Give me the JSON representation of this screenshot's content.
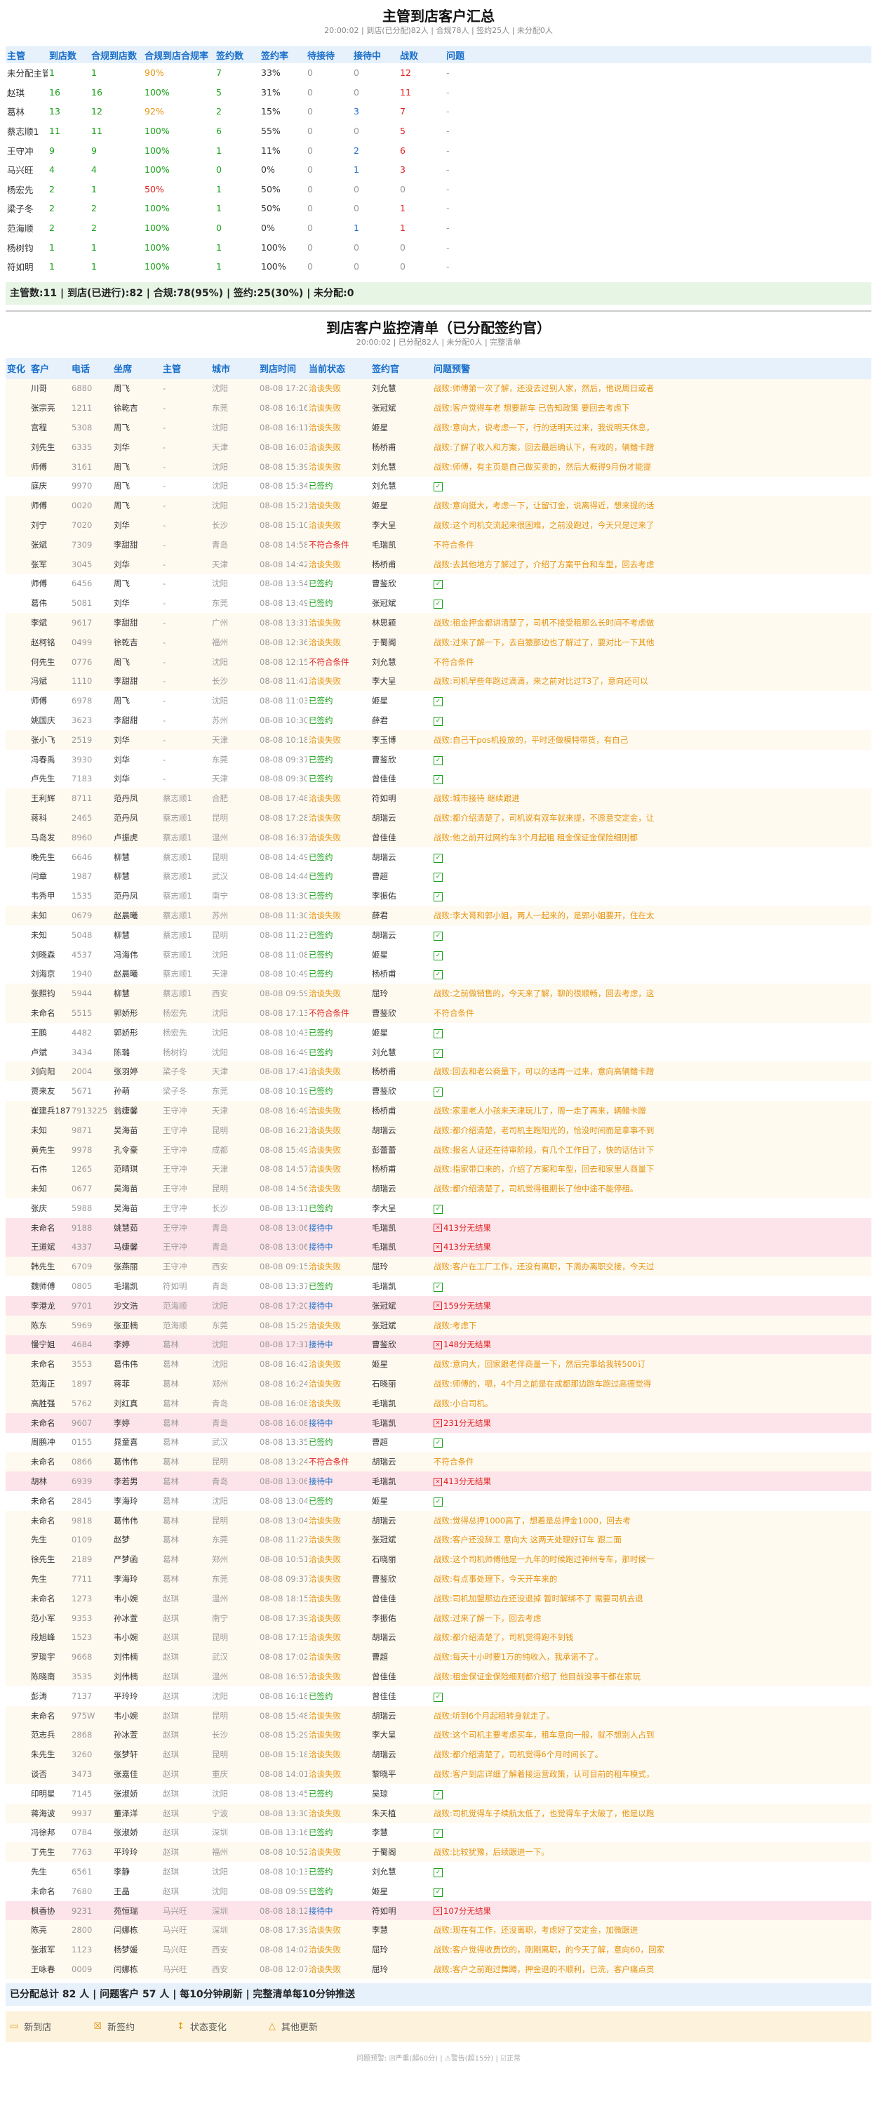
{
  "summary": {
    "title": "主管到店客户汇总",
    "subtitle": "20:00:02 | 到店(已分配)82人 | 合规78人 | 签约25人 | 未分配0人",
    "headers": [
      "主管",
      "到店数",
      "合规到店数",
      "合规到店合规率",
      "签约数",
      "签约率",
      "待接待",
      "接待中",
      "战败",
      "问题"
    ],
    "rows": [
      [
        "未分配主管",
        1,
        1,
        "90%",
        7,
        "33%",
        0,
        0,
        12,
        "-"
      ],
      [
        "赵琪",
        16,
        16,
        "100%",
        5,
        "31%",
        0,
        0,
        11,
        "-"
      ],
      [
        "葛林",
        13,
        12,
        "92%",
        2,
        "15%",
        0,
        3,
        7,
        "-"
      ],
      [
        "蔡志顺1",
        11,
        11,
        "100%",
        6,
        "55%",
        0,
        0,
        5,
        "-"
      ],
      [
        "王守冲",
        9,
        9,
        "100%",
        1,
        "11%",
        0,
        2,
        6,
        "-"
      ],
      [
        "马兴旺",
        4,
        4,
        "100%",
        0,
        "0%",
        0,
        1,
        3,
        "-"
      ],
      [
        "杨宏先",
        2,
        1,
        "50%",
        1,
        "50%",
        0,
        0,
        0,
        "-"
      ],
      [
        "梁子冬",
        2,
        2,
        "100%",
        1,
        "50%",
        0,
        0,
        1,
        "-"
      ],
      [
        "范海顺",
        2,
        2,
        "100%",
        0,
        "0%",
        0,
        1,
        1,
        "-"
      ],
      [
        "杨树钧",
        1,
        1,
        "100%",
        1,
        "100%",
        0,
        0,
        0,
        "-"
      ],
      [
        "符如明",
        1,
        1,
        "100%",
        1,
        "100%",
        0,
        0,
        0,
        "-"
      ]
    ],
    "total": "主管数:11 | 到店(已进行):82 | 合规:78(95%) | 签约:25(30%) | 未分配:0"
  },
  "monitor": {
    "title": "到店客户监控清单（已分配签约官）",
    "subtitle": "20:00:02 | 已分配82人 | 未分配0人 | 完整清单",
    "headers": [
      "变化",
      "客户",
      "电话",
      "坐席",
      "主管",
      "城市",
      "到店时间",
      "当前状态",
      "签约官",
      "问题预警"
    ],
    "rows": [
      [
        "",
        "川哥",
        "6880",
        "周飞",
        "-",
        "沈阳",
        "08-08 17:20",
        "洽谈失败",
        "刘允慧",
        "战败:师傅第一次了解，还没去过别人家，然后，他说周日或者",
        "w"
      ],
      [
        "",
        "张宗亮",
        "1211",
        "徐乾吉",
        "-",
        "东莞",
        "08-08 16:16",
        "洽谈失败",
        "张冠斌",
        "战败:客户觉得车老 想要新车 已告知政策 要回去考虑下",
        "w"
      ],
      [
        "",
        "宫程",
        "5308",
        "周飞",
        "-",
        "沈阳",
        "08-08 16:11",
        "洽谈失败",
        "姬星",
        "战败:意向大，说考虑一下，行的话明天过来，我说明天休息，",
        "w"
      ],
      [
        "",
        "刘先生",
        "6335",
        "刘华",
        "-",
        "天津",
        "08-08 16:03",
        "洽谈失败",
        "杨桥甫",
        "战败:了解了收入和方案，回去最后确认下，有戏的，辆鳍卡蹭",
        "w"
      ],
      [
        "",
        "师傅",
        "3161",
        "周飞",
        "-",
        "沈阳",
        "08-08 15:39",
        "洽谈失败",
        "刘允慧",
        "战败:师傅，有主页是自己做买卖的，然后大概得9月份才能提",
        "w"
      ],
      [
        "",
        "庭庆",
        "9970",
        "周飞",
        "-",
        "沈阳",
        "08-08 15:34",
        "已签约",
        "刘允慧",
        "",
        "ok"
      ],
      [
        "",
        "师傅",
        "0020",
        "周飞",
        "-",
        "沈阳",
        "08-08 15:21",
        "洽谈失败",
        "姬星",
        "战败:意向挺大，考虑一下，让留订金，说离得近，想来提的话",
        "w"
      ],
      [
        "",
        "刘宁",
        "7020",
        "刘华",
        "-",
        "长沙",
        "08-08 15:10",
        "洽谈失败",
        "李大呈",
        "战败:这个司机交流起来很困难，之前没跑过，今天只是过来了",
        "w"
      ],
      [
        "",
        "张斌",
        "7309",
        "李甜甜",
        "-",
        "青岛",
        "08-08 14:58",
        "不符合条件",
        "毛瑞凯",
        "不符合条件",
        "w"
      ],
      [
        "",
        "张军",
        "3045",
        "刘华",
        "-",
        "天津",
        "08-08 14:42",
        "洽谈失败",
        "杨桥甫",
        "战败:去其他地方了解过了，介绍了方案平台和车型，回去考虑",
        "w"
      ],
      [
        "",
        "师傅",
        "6456",
        "周飞",
        "-",
        "沈阳",
        "08-08 13:54",
        "已签约",
        "曹鉴欣",
        "",
        "ok"
      ],
      [
        "",
        "葛伟",
        "5081",
        "刘华",
        "-",
        "东莞",
        "08-08 13:49",
        "已签约",
        "张冠斌",
        "",
        "ok"
      ],
      [
        "",
        "李斌",
        "9617",
        "李甜甜",
        "-",
        "广州",
        "08-08 13:31",
        "洽谈失败",
        "林思颖",
        "战败:租金押金都讲清楚了，司机不接受租那么长时间不考虑做",
        "w"
      ],
      [
        "",
        "赵柯铭",
        "0499",
        "徐乾吉",
        "-",
        "福州",
        "08-08 12:36",
        "洽谈失败",
        "于蜀阁",
        "战败:过来了解一下，去自猿那边也了解过了，要对比一下其他",
        "w"
      ],
      [
        "",
        "何先生",
        "0776",
        "周飞",
        "-",
        "沈阳",
        "08-08 12:15",
        "不符合条件",
        "刘允慧",
        "不符合条件",
        "w"
      ],
      [
        "",
        "冯斌",
        "1110",
        "李甜甜",
        "-",
        "长沙",
        "08-08 11:41",
        "洽谈失败",
        "李大呈",
        "战败:司机早些年跑过滴滴，来之前对比过T3了，意向还可以",
        "w"
      ],
      [
        "",
        "师傅",
        "6978",
        "周飞",
        "-",
        "沈阳",
        "08-08 11:03",
        "已签约",
        "姬星",
        "",
        "ok"
      ],
      [
        "",
        "姚国庆",
        "3623",
        "李甜甜",
        "-",
        "苏州",
        "08-08 10:30",
        "已签约",
        "薛君",
        "",
        "ok"
      ],
      [
        "",
        "张小飞",
        "2519",
        "刘华",
        "-",
        "天津",
        "08-08 10:18",
        "洽谈失败",
        "李玉博",
        "战败:自己干pos机投放的，平时还做模特带货，有自己",
        "w"
      ],
      [
        "",
        "冯春禹",
        "3930",
        "刘华",
        "-",
        "东莞",
        "08-08 09:37",
        "已签约",
        "曹鉴欣",
        "",
        "ok"
      ],
      [
        "",
        "卢先生",
        "7183",
        "刘华",
        "-",
        "天津",
        "08-08 09:30",
        "已签约",
        "曾佳佳",
        "",
        "ok"
      ],
      [
        "",
        "王利辉",
        "8711",
        "范丹凤",
        "蔡志顺1",
        "合肥",
        "08-08 17:48",
        "洽谈失败",
        "符如明",
        "战败:城市接待 继续跟进",
        "w"
      ],
      [
        "",
        "蒋科",
        "2465",
        "范丹凤",
        "蔡志顺1",
        "昆明",
        "08-08 17:28",
        "洽谈失败",
        "胡瑞云",
        "战败:都介绍清楚了，司机说有双车就来提，不愿意交定金，让",
        "w"
      ],
      [
        "",
        "马岛发",
        "8960",
        "卢振虎",
        "蔡志顺1",
        "温州",
        "08-08 16:37",
        "洽谈失败",
        "曾佳佳",
        "战败:他之前开过网约车3个月起租 租金保证金保险细则都",
        "w"
      ],
      [
        "",
        "晚先生",
        "6646",
        "柳慧",
        "蔡志顺1",
        "昆明",
        "08-08 14:49",
        "已签约",
        "胡瑞云",
        "",
        "ok"
      ],
      [
        "",
        "闫章",
        "1987",
        "柳慧",
        "蔡志顺1",
        "武汉",
        "08-08 14:44",
        "已签约",
        "曹超",
        "",
        "ok"
      ],
      [
        "",
        "韦秀甲",
        "1535",
        "范丹凤",
        "蔡志顺1",
        "南宁",
        "08-08 13:30",
        "已签约",
        "李振佑",
        "",
        "ok"
      ],
      [
        "",
        "未知",
        "0679",
        "赵晨曦",
        "蔡志顺1",
        "苏州",
        "08-08 11:30",
        "洽谈失败",
        "薛君",
        "战败:李大哥和郭小姐，两人一起来的，是郭小姐要开，住在太",
        "w"
      ],
      [
        "",
        "未知",
        "5048",
        "柳慧",
        "蔡志顺1",
        "昆明",
        "08-08 11:23",
        "已签约",
        "胡瑞云",
        "",
        "ok"
      ],
      [
        "",
        "刘晓森",
        "4537",
        "冯海伟",
        "蔡志顺1",
        "沈阳",
        "08-08 11:08",
        "已签约",
        "姬星",
        "",
        "ok"
      ],
      [
        "",
        "刘海京",
        "1940",
        "赵晨曦",
        "蔡志顺1",
        "天津",
        "08-08 10:49",
        "已签约",
        "杨桥甫",
        "",
        "ok"
      ],
      [
        "",
        "张照钧",
        "5944",
        "柳慧",
        "蔡志顺1",
        "西安",
        "08-08 09:59",
        "洽谈失败",
        "屈玲",
        "战败:之前做销售的，今天来了解，聊的很顺畅，回去考虑，这",
        "w"
      ],
      [
        "",
        "未命名",
        "5515",
        "郭娇形",
        "杨宏先",
        "沈阳",
        "08-08 17:13",
        "不符合条件",
        "曹鉴欣",
        "不符合条件",
        "w"
      ],
      [
        "",
        "王鹏",
        "4482",
        "郭娇形",
        "杨宏先",
        "沈阳",
        "08-08 10:43",
        "已签约",
        "姬星",
        "",
        "ok"
      ],
      [
        "",
        "卢斌",
        "3434",
        "陈璐",
        "杨树钧",
        "沈阳",
        "08-08 16:49",
        "已签约",
        "刘允慧",
        "",
        "ok"
      ],
      [
        "",
        "刘向阳",
        "2004",
        "张羽婷",
        "梁子冬",
        "天津",
        "08-08 17:41",
        "洽谈失败",
        "杨桥甫",
        "战败:回去和老公商量下，可以的话再一过来，意向高辆鳍卡蹭",
        "w"
      ],
      [
        "",
        "贾来友",
        "5671",
        "孙萌",
        "梁子冬",
        "东莞",
        "08-08 10:19",
        "已签约",
        "曹鉴欣",
        "",
        "ok"
      ],
      [
        "",
        "崔建兵1870",
        "7913225",
        "翁婕馨",
        "王守冲",
        "天津",
        "08-08 16:49",
        "洽谈失败",
        "杨桥甫",
        "战败:家里老人小孩来天津玩儿了，周一走了再来，辆鳍卡蹭",
        "w"
      ],
      [
        "",
        "未知",
        "9871",
        "吴海苗",
        "王守冲",
        "昆明",
        "08-08 16:21",
        "洽谈失败",
        "胡瑞云",
        "战败:都介绍清楚，老司机主跑阳光的，恰没时间而是拿事不到",
        "w"
      ],
      [
        "",
        "黄先生",
        "9978",
        "孔令豪",
        "王守冲",
        "成都",
        "08-08 15:49",
        "洽谈失败",
        "彭蕾蕾",
        "战败:报名人证还在待审阶段，有几个工作日了，快的话估计下",
        "w"
      ],
      [
        "",
        "石伟",
        "1265",
        "范晴琪",
        "王守冲",
        "天津",
        "08-08 14:57",
        "洽谈失败",
        "杨桥甫",
        "战败:指家带口来的，介绍了方案和车型，回去和家里人商量下",
        "w"
      ],
      [
        "",
        "未知",
        "0677",
        "吴海苗",
        "王守冲",
        "昆明",
        "08-08 14:56",
        "洽谈失败",
        "胡瑞云",
        "战败:都介绍清楚了，司机觉得租期长了他中途不能停租。",
        "w"
      ],
      [
        "",
        "张庆",
        "5988",
        "吴海苗",
        "王守冲",
        "长沙",
        "08-08 13:11",
        "已签约",
        "李大呈",
        "",
        "ok"
      ],
      [
        "",
        "未命名",
        "9188",
        "姚慧茹",
        "王守冲",
        "青岛",
        "08-08 13:06",
        "接待中",
        "毛瑞凯",
        "413分无结果",
        "r"
      ],
      [
        "",
        "王道斌",
        "4337",
        "马婕馨",
        "王守冲",
        "青岛",
        "08-08 13:06",
        "接待中",
        "毛瑞凯",
        "413分无结果",
        "r"
      ],
      [
        "",
        "韩先生",
        "6709",
        "张燕丽",
        "王守冲",
        "西安",
        "08-08 09:15",
        "洽谈失败",
        "屈玲",
        "战败:客户在工厂工作，还没有离职，下周办离职交接，今天过",
        "w"
      ],
      [
        "",
        "魏师傅",
        "0805",
        "毛瑞凯",
        "符如明",
        "青岛",
        "08-08 13:37",
        "已签约",
        "毛瑞凯",
        "",
        "ok"
      ],
      [
        "",
        "李港龙",
        "9701",
        "沙文浩",
        "范海顺",
        "沈阳",
        "08-08 17:20",
        "接待中",
        "张冠斌",
        "159分无结果",
        "r"
      ],
      [
        "",
        "陈东",
        "5969",
        "张亚楠",
        "范海顺",
        "东莞",
        "08-08 15:29",
        "洽谈失败",
        "张冠斌",
        "战败:考虑下",
        "w"
      ],
      [
        "",
        "慢宁姐",
        "4684",
        "李婷",
        "葛林",
        "沈阳",
        "08-08 17:31",
        "接待中",
        "曹鉴欣",
        "148分无结果",
        "r"
      ],
      [
        "",
        "未命名",
        "3553",
        "葛伟伟",
        "葛林",
        "沈阳",
        "08-08 16:42",
        "洽谈失败",
        "姬星",
        "战败:意向大，回家跟老伴商量一下，然后完事给我转500订",
        "w"
      ],
      [
        "",
        "范海正",
        "1897",
        "蒋菲",
        "葛林",
        "郑州",
        "08-08 16:24",
        "洽谈失败",
        "石晓丽",
        "战败:师傅的，嗯，4个月之前是在成都那边跑车跑过高德觉得",
        "w"
      ],
      [
        "",
        "高胜强",
        "5762",
        "刘红真",
        "葛林",
        "青岛",
        "08-08 16:08",
        "洽谈失败",
        "毛瑞凯",
        "战败:小白司机。",
        "w"
      ],
      [
        "",
        "未命名",
        "9607",
        "李婷",
        "葛林",
        "青岛",
        "08-08 16:08",
        "接待中",
        "毛瑞凯",
        "231分无结果",
        "r"
      ],
      [
        "",
        "周鹏冲",
        "0155",
        "晁童喜",
        "葛林",
        "武汉",
        "08-08 13:35",
        "已签约",
        "曹超",
        "",
        "ok"
      ],
      [
        "",
        "未命名",
        "0866",
        "葛伟伟",
        "葛林",
        "昆明",
        "08-08 13:24",
        "不符合条件",
        "胡瑞云",
        "不符合条件",
        "w"
      ],
      [
        "",
        "胡林",
        "6939",
        "李若男",
        "葛林",
        "青岛",
        "08-08 13:06",
        "接待中",
        "毛瑞凯",
        "413分无结果",
        "r"
      ],
      [
        "",
        "未命名",
        "2845",
        "李海玲",
        "葛林",
        "沈阳",
        "08-08 13:04",
        "已签约",
        "姬星",
        "",
        "ok"
      ],
      [
        "",
        "未命名",
        "9818",
        "葛伟伟",
        "葛林",
        "昆明",
        "08-08 13:04",
        "洽谈失败",
        "胡瑞云",
        "战败:觉得总押1000高了，想着是总押金1000，回去考",
        "w"
      ],
      [
        "",
        "先生",
        "0109",
        "赵梦",
        "葛林",
        "东莞",
        "08-08 11:27",
        "洽谈失败",
        "张冠斌",
        "战败:客户还没辞工 意向大 这两天处理好订车 跟二面",
        "w"
      ],
      [
        "",
        "徐先生",
        "2189",
        "严梦函",
        "葛林",
        "郑州",
        "08-08 10:51",
        "洽谈失败",
        "石晓丽",
        "战败:这个司机师傅他是一九年的时候跑过神州专车，那时候一",
        "w"
      ],
      [
        "",
        "先生",
        "7711",
        "李海玲",
        "葛林",
        "东莞",
        "08-08 09:37",
        "洽谈失败",
        "曹鉴欣",
        "战败:有点事处理下，今天开车来的",
        "w"
      ],
      [
        "",
        "未命名",
        "1273",
        "韦小婉",
        "赵琪",
        "温州",
        "08-08 18:15",
        "洽谈失败",
        "曾佳佳",
        "战败:司机加盟那边在还没退掉 暂时解绑不了 需要司机去退",
        "w"
      ],
      [
        "",
        "范小军",
        "9353",
        "孙冰萱",
        "赵琪",
        "南宁",
        "08-08 17:39",
        "洽谈失败",
        "李振佑",
        "战败:过来了解一下，回去考虑",
        "w"
      ],
      [
        "",
        "段旭峰",
        "1523",
        "韦小婉",
        "赵琪",
        "昆明",
        "08-08 17:15",
        "洽谈失败",
        "胡瑞云",
        "战败:都介绍清楚了，司机觉得跑不到钱",
        "w"
      ],
      [
        "",
        "罗琰宇",
        "9668",
        "刘伟楠",
        "赵琪",
        "武汉",
        "08-08 17:02",
        "洽谈失败",
        "曹超",
        "战败:每天十小时要1万的纯收入，我承诺不了。",
        "w"
      ],
      [
        "",
        "陈晓南",
        "3535",
        "刘伟楠",
        "赵琪",
        "温州",
        "08-08 16:57",
        "洽谈失败",
        "曾佳佳",
        "战败:租金保证金保险细则都介绍了 他目前没事干都在家玩",
        "w"
      ],
      [
        "",
        "彭涛",
        "7137",
        "平玲玲",
        "赵琪",
        "沈阳",
        "08-08 16:18",
        "已签约",
        "曾佳佳",
        "",
        "ok"
      ],
      [
        "",
        "未命名",
        "975W",
        "韦小婉",
        "赵琪",
        "昆明",
        "08-08 15:48",
        "洽谈失败",
        "胡瑞云",
        "战败:听到6个月起租转身就走了。",
        "w"
      ],
      [
        "",
        "范志兵",
        "2868",
        "孙冰萱",
        "赵琪",
        "长沙",
        "08-08 15:29",
        "洽谈失败",
        "李大呈",
        "战败:这个司机主要考虑买车，租车意向一般，就不想别人占到",
        "w"
      ],
      [
        "",
        "朱先生",
        "3260",
        "张梦轩",
        "赵琪",
        "昆明",
        "08-08 15:18",
        "洽谈失败",
        "胡瑞云",
        "战败:都介绍清楚了，司机觉得6个月时间长了。",
        "w"
      ],
      [
        "",
        "谈否",
        "3473",
        "张嘉佳",
        "赵琪",
        "重庆",
        "08-08 14:01",
        "洽谈失败",
        "黎晓平",
        "战败:客户到店详细了解着接运营政策，认可目前的租车模式，",
        "w"
      ],
      [
        "",
        "印明星",
        "7145",
        "张淑娇",
        "赵琪",
        "沈阳",
        "08-08 13:45",
        "已签约",
        "吴琼",
        "",
        "ok"
      ],
      [
        "",
        "蒋海波",
        "9937",
        "董泽洋",
        "赵琪",
        "宁波",
        "08-08 13:30",
        "洽谈失败",
        "朱天植",
        "战败:司机觉得车子续航太低了，也觉得车子太破了，他是以跑",
        "w"
      ],
      [
        "",
        "冯徐邦",
        "0784",
        "张淑娇",
        "赵琪",
        "深圳",
        "08-08 13:16",
        "已签约",
        "李慧",
        "",
        "ok"
      ],
      [
        "",
        "丁先生",
        "7763",
        "平玲玲",
        "赵琪",
        "福州",
        "08-08 10:52",
        "洽谈失败",
        "于蜀阁",
        "战败:比较犹豫，后续跟进一下。",
        "w"
      ],
      [
        "",
        "先生",
        "6561",
        "李静",
        "赵琪",
        "沈阳",
        "08-08 10:13",
        "已签约",
        "刘允慧",
        "",
        "ok"
      ],
      [
        "",
        "未命名",
        "7680",
        "王晶",
        "赵琪",
        "沈阳",
        "08-08 09:59",
        "已签约",
        "姬星",
        "",
        "ok"
      ],
      [
        "",
        "枫香协",
        "9231",
        "苑恒瑞",
        "马兴旺",
        "深圳",
        "08-08 18:12",
        "接待中",
        "符如明",
        "107分无结果",
        "r"
      ],
      [
        "",
        "陈亮",
        "2800",
        "闫娜栋",
        "马兴旺",
        "深圳",
        "08-08 17:39",
        "洽谈失败",
        "李慧",
        "战败:现在有工作，还没离职，考虑好了交定金，加微跟进",
        "w"
      ],
      [
        "",
        "张淑军",
        "1123",
        "杨梦媛",
        "马兴旺",
        "西安",
        "08-08 14:02",
        "洽谈失败",
        "屈玲",
        "战败:客户觉得收费饮的，刚刚离职，的今天了解，意向60，回家",
        "w"
      ],
      [
        "",
        "王咏春",
        "0009",
        "闫娜栋",
        "马兴旺",
        "西安",
        "08-08 12:07",
        "洽谈失败",
        "屈玲",
        "战败:客户之前跑过舞蹲，押金退的不顺利，已洗，客户痛点贯",
        "w"
      ]
    ],
    "footer": "已分配总计 82 人 | 问题客户 57 人 | 每10分钟刷新 | 完整清单每10分钟推送"
  },
  "legend": {
    "items": [
      {
        "icon": "new-arrival-icon",
        "label": "新到店"
      },
      {
        "icon": "new-signed-icon",
        "label": "新签约"
      },
      {
        "icon": "status-change-icon",
        "label": "状态变化"
      },
      {
        "icon": "other-update-icon",
        "label": "其他更新"
      }
    ],
    "footnote": "问题预警: ☒严重(超60分) | ⚠警告(超15分) | ☑正常"
  }
}
